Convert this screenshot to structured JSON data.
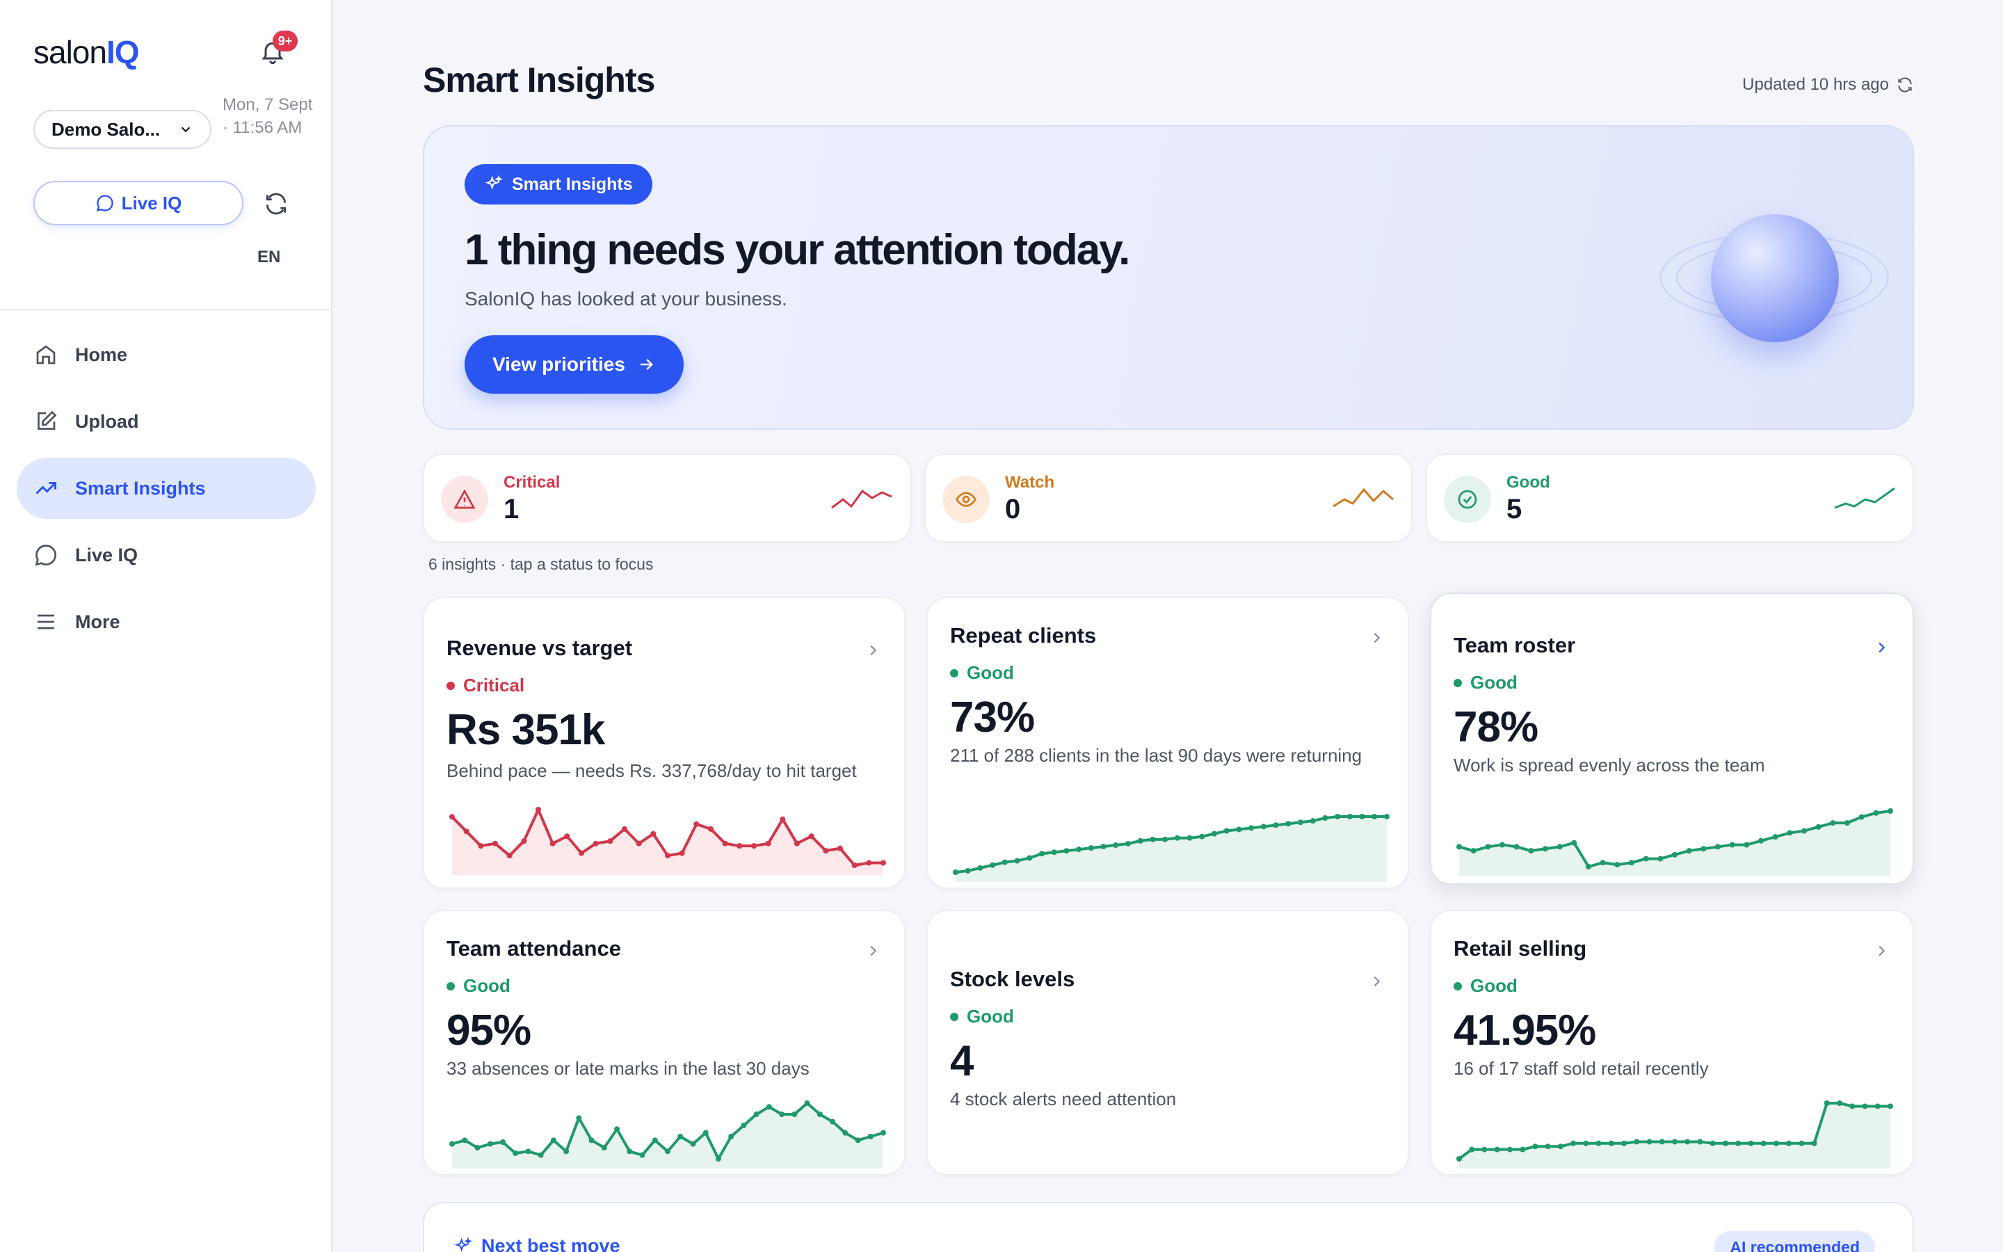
{
  "sidebar": {
    "logo_prefix": "salon",
    "logo_suffix": "IQ",
    "notification_badge": "9+",
    "salon_name": "Demo Salo...",
    "datetime": "Mon, 7 Sept · 11:56 AM",
    "liveiq_button": "Live IQ",
    "language": "EN",
    "nav": [
      {
        "label": "Home",
        "icon": "home-icon"
      },
      {
        "label": "Upload",
        "icon": "upload-icon"
      },
      {
        "label": "Smart Insights",
        "icon": "trend-icon",
        "active": true
      },
      {
        "label": "Live IQ",
        "icon": "chat-icon"
      },
      {
        "label": "More",
        "icon": "menu-icon"
      }
    ]
  },
  "header": {
    "title": "Smart Insights",
    "updated": "Updated 10 hrs ago"
  },
  "hero": {
    "pill": "Smart Insights",
    "title": "1 thing needs your attention today.",
    "subtitle": "SalonIQ has looked at your business.",
    "button": "View priorities"
  },
  "statuses": [
    {
      "label": "Critical",
      "count": "1",
      "color": "#d1364a",
      "bg": "#fde7e6"
    },
    {
      "label": "Watch",
      "count": "0",
      "color": "#d07a1e",
      "bg": "#fdeadb"
    },
    {
      "label": "Good",
      "count": "5",
      "color": "#1f9a6a",
      "bg": "#e4f3ec"
    }
  ],
  "insight_hint": "6 insights · tap a status to focus",
  "cards": [
    {
      "title": "Revenue vs target",
      "status": "Critical",
      "value": "Rs 351k",
      "desc": "Behind pace — needs Rs. 337,768/day to hit target",
      "color": "#d1364a",
      "series": [
        42,
        30,
        18,
        20,
        10,
        22,
        48,
        20,
        26,
        12,
        20,
        22,
        32,
        20,
        28,
        10,
        12,
        36,
        32,
        20,
        18,
        18,
        20,
        40,
        20,
        26,
        14,
        16,
        2,
        4,
        4
      ]
    },
    {
      "title": "Repeat clients",
      "status": "Good",
      "value": "73%",
      "desc": "211 of 288 clients in the last 90 days were returning",
      "color": "#1f9a6a",
      "series": [
        5,
        6,
        8,
        10,
        12,
        13,
        15,
        18,
        19,
        20,
        21,
        22,
        23,
        24,
        25,
        27,
        28,
        28,
        29,
        29,
        30,
        32,
        34,
        35,
        36,
        37,
        38,
        39,
        40,
        41,
        43,
        44,
        44,
        44,
        44,
        44
      ]
    },
    {
      "title": "Team roster",
      "status": "Good",
      "value": "78%",
      "desc": "Work is spread evenly across the team",
      "color": "#1f9a6a",
      "series": [
        30,
        28,
        30,
        31,
        30,
        28,
        29,
        30,
        32,
        20,
        22,
        21,
        22,
        24,
        24,
        26,
        28,
        29,
        30,
        31,
        31,
        33,
        35,
        37,
        38,
        40,
        42,
        42,
        45,
        47,
        48
      ]
    },
    {
      "title": "Team attendance",
      "status": "Good",
      "value": "95%",
      "desc": "33 absences or late marks in the last 30 days",
      "color": "#1f9a6a",
      "series": [
        20,
        22,
        18,
        20,
        21,
        15,
        16,
        14,
        22,
        16,
        34,
        22,
        18,
        28,
        16,
        14,
        22,
        16,
        24,
        20,
        26,
        12,
        24,
        30,
        36,
        40,
        36,
        36,
        42,
        36,
        32,
        26,
        22,
        24,
        26
      ]
    },
    {
      "title": "Stock levels",
      "status": "Good",
      "value": "4",
      "desc": "4 stock alerts need attention",
      "color": "#1f9a6a",
      "series": []
    },
    {
      "title": "Retail selling",
      "status": "Good",
      "value": "41.95%",
      "desc": "16 of 17 staff sold retail recently",
      "color": "#1f9a6a",
      "series": [
        4,
        10,
        10,
        10,
        10,
        10,
        12,
        12,
        12,
        14,
        14,
        14,
        14,
        14,
        15,
        15,
        15,
        15,
        15,
        15,
        14,
        14,
        14,
        14,
        14,
        14,
        14,
        14,
        14,
        40,
        40,
        38,
        38,
        38,
        38
      ]
    }
  ],
  "next_move": {
    "title": "Next best move",
    "badge": "AI recommended"
  }
}
